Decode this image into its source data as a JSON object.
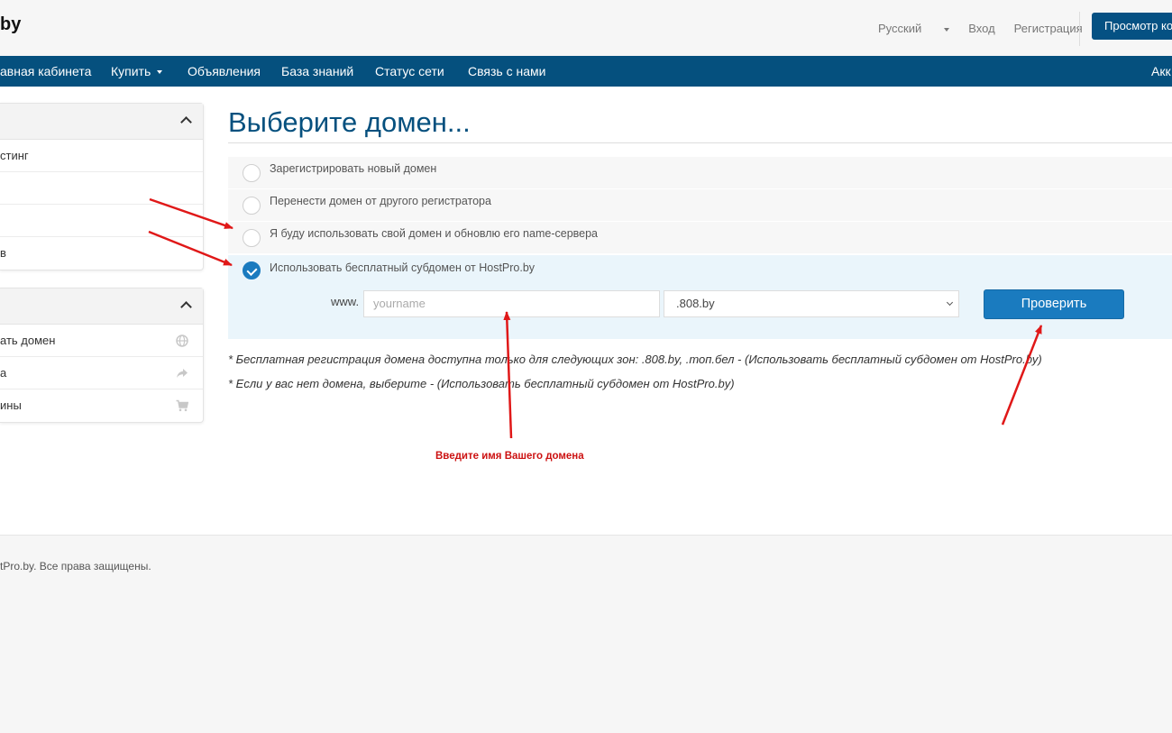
{
  "header": {
    "logo": "by",
    "language": "Русский",
    "login": "Вход",
    "register": "Регистрация",
    "cart_button": "Просмотр ко"
  },
  "nav": {
    "items": [
      {
        "label": "авная кабинета"
      },
      {
        "label": "Купить"
      },
      {
        "label": "Объявления"
      },
      {
        "label": "База знаний"
      },
      {
        "label": "Статус сети"
      },
      {
        "label": "Связь с нами"
      },
      {
        "label": "Акк"
      }
    ]
  },
  "sidebar": {
    "panel1": {
      "rows": [
        "стинг",
        "",
        "",
        "в"
      ]
    },
    "panel2": {
      "rows": [
        {
          "label": "ать домен",
          "icon": "globe-icon"
        },
        {
          "label": "а",
          "icon": "share-arrow-icon"
        },
        {
          "label": "ины",
          "icon": "cart-icon"
        }
      ]
    }
  },
  "main": {
    "title": "Выберите домен...",
    "options": [
      {
        "label": "Зарегистрировать новый домен",
        "checked": false
      },
      {
        "label": "Перенести домен от другого регистратора",
        "checked": false
      },
      {
        "label": "Я буду использовать свой домен и обновлю его name-сервера",
        "checked": false
      },
      {
        "label": "Использовать бесплатный субдомен от HostPro.by",
        "checked": true
      }
    ],
    "www_label": "www.",
    "domain_placeholder": "yourname",
    "zone_selected": ".808.by",
    "check_button": "Проверить",
    "note1": "* Бесплатная регистрация домена доступна только для следующих зон: .808.by, .топ.бел - (Использовать бесплатный субдомен от HostPro.by)",
    "note2": "* Если у вас нет домена, выберите - (Использовать бесплатный субдомен от HostPro.by)",
    "annotation": "Введите имя Вашего домена"
  },
  "footer": {
    "copyright": "tPro.by. Все права защищены."
  },
  "colors": {
    "brand": "#05507e",
    "accent": "#1a7bbf",
    "annotation": "#cc1111"
  }
}
